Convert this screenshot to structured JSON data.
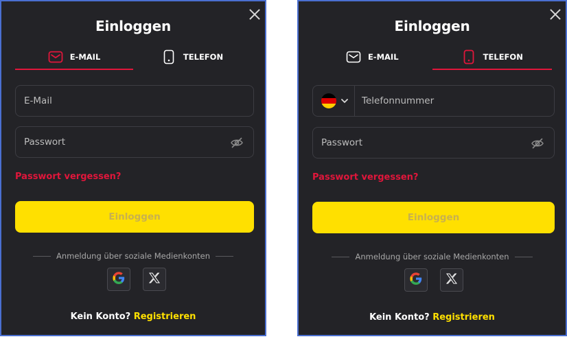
{
  "left": {
    "title": "Einloggen",
    "tabs": [
      {
        "label": "E-MAIL",
        "icon": "mail-icon",
        "active": true
      },
      {
        "label": "TELEFON",
        "icon": "phone-icon",
        "active": false
      }
    ],
    "email_placeholder": "E-Mail",
    "password_placeholder": "Passwort",
    "forgot_label": "Passwort vergessen?",
    "login_label": "Einloggen",
    "social_label": "Anmeldung über soziale Medienkonten",
    "no_account_label": "Kein Konto?",
    "register_label": "Registrieren"
  },
  "right": {
    "title": "Einloggen",
    "tabs": [
      {
        "label": "E-MAIL",
        "icon": "mail-icon",
        "active": false
      },
      {
        "label": "TELEFON",
        "icon": "phone-icon",
        "active": true
      }
    ],
    "country_flag": "germany-flag",
    "phone_placeholder": "Telefonnummer",
    "password_placeholder": "Passwort",
    "forgot_label": "Passwort vergessen?",
    "login_label": "Einloggen",
    "social_label": "Anmeldung über soziale Medienkonten",
    "no_account_label": "Kein Konto?",
    "register_label": "Registrieren"
  },
  "colors": {
    "panel_bg": "#232327",
    "accent_red": "#e0163b",
    "accent_yellow": "#ffe000",
    "border": "#4a6fd0"
  }
}
